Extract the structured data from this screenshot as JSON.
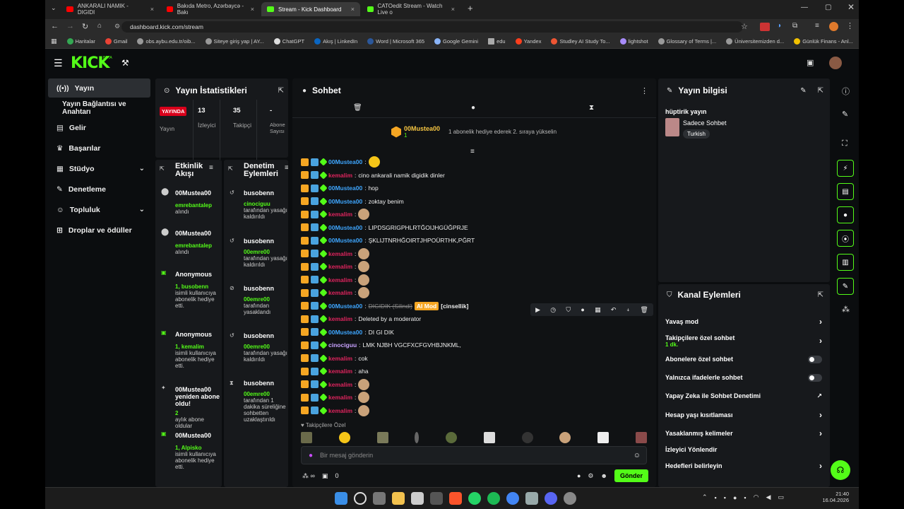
{
  "browser": {
    "tabs": [
      {
        "label": "ANKARALI NAMIK - DIGIDI"
      },
      {
        "label": "Bakıda Metro, Azərbaycə - Bakı"
      },
      {
        "label": "Stream - Kick Dashboard"
      },
      {
        "label": "CATOedit Stream - Watch Live o"
      }
    ],
    "url": "dashboard.kick.com/stream",
    "bookmarks": [
      "Haritalar",
      "Gmail",
      "obs.aybu.edu.tr/oib...",
      "Siteye giriş yap | AY...",
      "ChatGPT",
      "Akış | LinkedIn",
      "Word | Microsoft 365",
      "Google Gemini",
      "edu",
      "Yandex",
      "Studley AI Study To...",
      "lightshot",
      "Glossary of Terms |...",
      "Üniversitemizden d...",
      "Günlük Finans - Anl..."
    ]
  },
  "app": {
    "logo": "KICK",
    "logo_sup": "BETA",
    "nav": {
      "stream": "Yayın",
      "connection": "Yayın Bağlantısı ve Anahtarı",
      "income": "Gelir",
      "achievements": "Başarılar",
      "studio": "Stüdyo",
      "moderation": "Denetleme",
      "community": "Topluluk",
      "drops": "Droplar ve ödüller"
    },
    "stats": {
      "title": "Yayın İstatistikleri",
      "live_badge": "YAYINDA",
      "live_label": "Yayın",
      "viewers_value": "13",
      "viewers_label": "İzleyici",
      "followers_value": "35",
      "followers_label": "Takipçi",
      "subs_value": "-",
      "subs_label": "Abone Sayısı"
    },
    "activity": {
      "title": "Etkinlik Akışı",
      "items": [
        {
          "user": "00Mustea00",
          "sub": "emrebantalep",
          "tail": "alındı"
        },
        {
          "user": "00Mustea00",
          "sub": "emrebantalep",
          "tail": "alındı"
        },
        {
          "user": "Anonymous",
          "sub": "1, busobenn",
          "tail": "isimli kullanıcıya abonelik hediye etti."
        },
        {
          "user": "Anonymous",
          "sub": "1, kemalim",
          "tail": "isimli kullanıcıya abonelik hediye etti."
        },
        {
          "user": "00Mustea00 yeniden abone oldu!",
          "sub": "2",
          "tail": "aylık abone oldular"
        },
        {
          "user": "00Mustea00",
          "sub": "1, Alpisko",
          "tail": "isimli kullanıcıya abonelik hediye etti."
        }
      ]
    },
    "modlog": {
      "title": "Denetim Eylemleri",
      "items": [
        {
          "user": "busobenn",
          "sub": "cinociguu",
          "tail": "tarafından yasağı kaldırıldı"
        },
        {
          "user": "busobenn",
          "sub": "00emre00",
          "tail": "tarafından yasağı kaldırıldı"
        },
        {
          "user": "busobenn",
          "sub": "00emre00",
          "tail": "tarafından yasaklandı"
        },
        {
          "user": "busobenn",
          "sub": "00emre00",
          "tail": "tarafından yasağı kaldırıldı"
        },
        {
          "user": "busobenn",
          "sub": "00emre00",
          "tail": "tarafından 1 dakika süreliğine sohbetten uzaklaştırıldı"
        }
      ]
    },
    "chat": {
      "title": "Sohbet",
      "pinned_user": "00Mustea00",
      "pinned_count": "1",
      "pinned_note": "1 abonelik hediye ederek 2. sıraya yükselin",
      "messages": [
        {
          "user": "00Mustea00",
          "color": "b",
          "text": "",
          "emote": true
        },
        {
          "user": "kemalim",
          "color": "r",
          "text": "cino ankarali namik digidik dinler",
          "emote": false
        },
        {
          "user": "00Mustea00",
          "color": "b",
          "text": "hop",
          "emote": false
        },
        {
          "user": "00Mustea00",
          "color": "b",
          "text": "zoktay benim",
          "emote": false
        },
        {
          "user": "kemalim",
          "color": "r",
          "text": "",
          "emote": true
        },
        {
          "user": "00Mustea00",
          "color": "b",
          "text": "LIPDSGRIGPHLRTĞOIJHGÜĞPRJE",
          "emote": false
        },
        {
          "user": "00Mustea00",
          "color": "b",
          "text": "ŞKLIJTNRHĞOIRTJHPOÜRTHK,PĞRT",
          "emote": false
        },
        {
          "user": "kemalim",
          "color": "r",
          "text": "",
          "emote": true
        },
        {
          "user": "kemalim",
          "color": "r",
          "text": "",
          "emote": true
        },
        {
          "user": "kemalim",
          "color": "r",
          "text": "",
          "emote": true
        },
        {
          "user": "kemalim",
          "color": "r",
          "text": "",
          "emote": true
        },
        {
          "user": "00Mustea00",
          "color": "b",
          "text": "DIGIDIK (Silindi)",
          "emote": false,
          "tag": "AI Mod",
          "tag2": "[cinsellik]"
        },
        {
          "user": "kemalim",
          "color": "r",
          "text": "Deleted by a moderator",
          "emote": false
        },
        {
          "user": "00Mustea00",
          "color": "b",
          "text": "DI GI DIK",
          "emote": false
        },
        {
          "user": "cinociguu",
          "color": "p",
          "text": "LMK NJBH VGCFXCFGVHBJNKML,",
          "emote": false
        },
        {
          "user": "kemalim",
          "color": "r",
          "text": "cok",
          "emote": false
        },
        {
          "user": "kemalim",
          "color": "r",
          "text": "aha",
          "emote": false
        },
        {
          "user": "kemalim",
          "color": "r",
          "text": "",
          "emote": true
        },
        {
          "user": "kemalim",
          "color": "r",
          "text": "",
          "emote": true
        },
        {
          "user": "kemalim",
          "color": "r",
          "text": "",
          "emote": true
        }
      ],
      "followers_only": "Takipçilere Özel",
      "input_placeholder": "Bir mesaj gönderin",
      "bottom_count": "0",
      "send": "Gönder"
    },
    "info": {
      "title": "Yayın bilgisi",
      "stream_title": "hüptirik yayın",
      "category": "Sadece Sohbet",
      "language": "Turkish"
    },
    "channel": {
      "title": "Kanal Eylemleri",
      "slow": "Yavaş mod",
      "followers_chat": "Takipçilere özel sohbet",
      "followers_chat_sub": "1 dk.",
      "subs_chat": "Abonelere özel sohbet",
      "emote_chat": "Yalnızca ifadelerle sohbet",
      "ai_mod": "Yapay Zeka ile Sohbet Denetimi",
      "age": "Hesap yaşı kısıtlaması",
      "banned_words": "Yasaklanmış kelimeler",
      "redirect": "İzleyici Yönlendir",
      "goals": "Hedefleri belirleyin"
    }
  },
  "taskbar": {
    "time": "21:40",
    "date": "16.04.2026"
  },
  "colors": {
    "accent": "#53fc18",
    "panel": "#17191c",
    "bg": "#0b0d0f"
  }
}
